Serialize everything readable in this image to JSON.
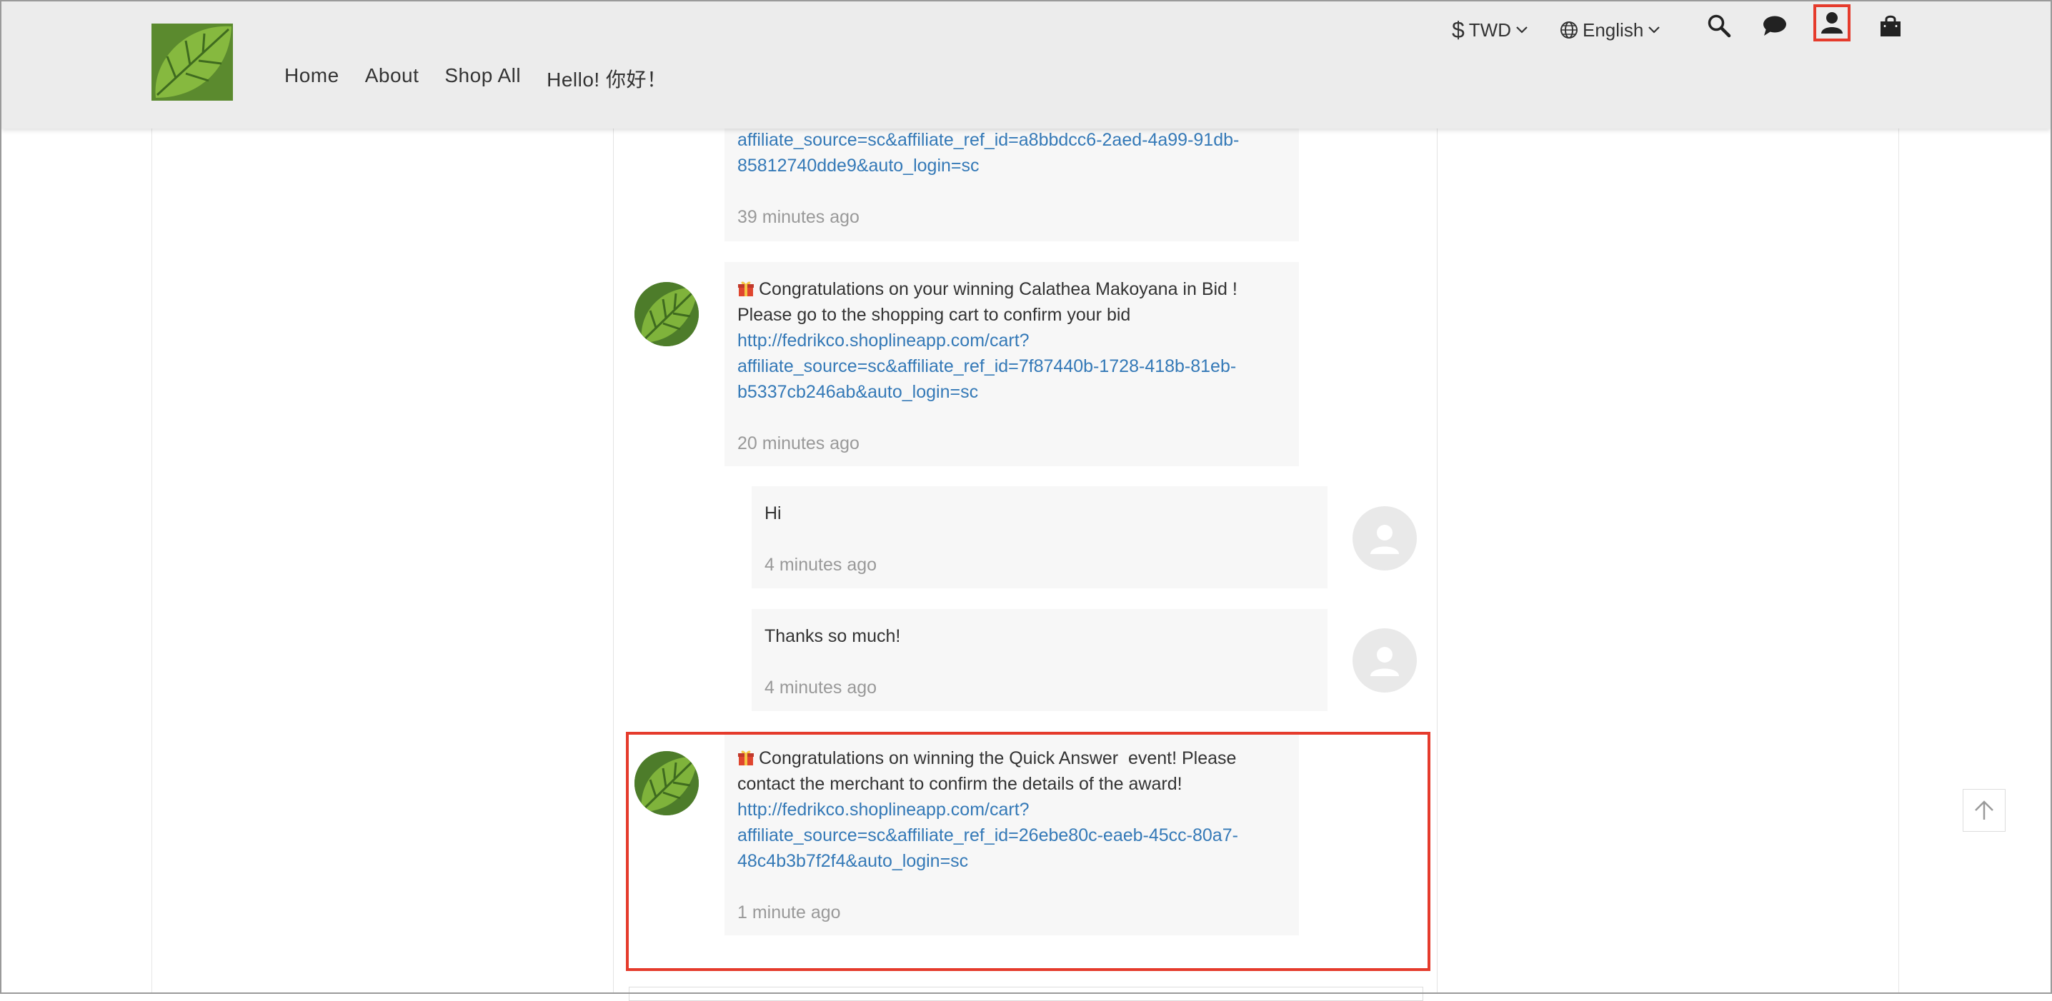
{
  "header": {
    "nav": [
      "Home",
      "About",
      "Shop All",
      "Hello! 你好！"
    ],
    "currency": {
      "symbol": "$",
      "label": "TWD"
    },
    "language": {
      "label": "English"
    },
    "icons": [
      "search-icon",
      "chat-icon",
      "user-icon",
      "shopping-bag-icon"
    ],
    "highlight_color": "#e53b2c"
  },
  "messages": [
    {
      "sender": "store",
      "text_lines": [],
      "link_lines": [
        "affiliate_source=sc&affiliate_ref_id=a8bbdcc6-2aed-4a99-91db-",
        "85812740dde9&auto_login=sc"
      ],
      "time": "39 minutes ago"
    },
    {
      "sender": "store",
      "text_lines": [
        "Congratulations on your winning Calathea Makoyana in Bid !",
        "Please go to the shopping cart to confirm your bid"
      ],
      "link_lines": [
        "http://fedrikco.shoplineapp.com/cart?",
        "affiliate_source=sc&affiliate_ref_id=7f87440b-1728-418b-81eb-",
        "b5337cb246ab&auto_login=sc"
      ],
      "time": "20 minutes ago"
    },
    {
      "sender": "user",
      "text": "Hi",
      "time": "4 minutes ago"
    },
    {
      "sender": "user",
      "text": "Thanks so much!",
      "time": "4 minutes ago"
    },
    {
      "sender": "store",
      "text_lines": [
        "Congratulations on winning the Quick Answer  event! Please",
        "contact the merchant to confirm the details of the award!"
      ],
      "link_lines": [
        "http://fedrikco.shoplineapp.com/cart?",
        "affiliate_source=sc&affiliate_ref_id=26ebe80c-eaeb-45cc-80a7-",
        "48c4b3b7f2f4&auto_login=sc"
      ],
      "time": "1 minute ago"
    }
  ]
}
